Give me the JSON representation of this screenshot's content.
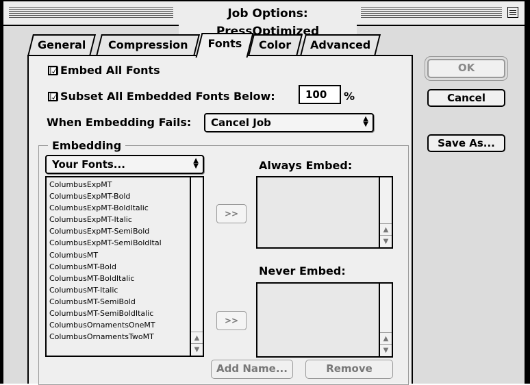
{
  "window": {
    "title": "Job Options: PressOptimized"
  },
  "tabs": [
    {
      "label": "General"
    },
    {
      "label": "Compression"
    },
    {
      "label": "Fonts"
    },
    {
      "label": "Color"
    },
    {
      "label": "Advanced"
    }
  ],
  "fonts": {
    "embed_all": {
      "label": "Embed All Fonts",
      "checked": true,
      "mark": "☑"
    },
    "subset": {
      "label": "Subset All Embedded Fonts Below:",
      "checked": true,
      "mark": "☑",
      "value": "100",
      "unit": "%"
    },
    "embedding_fails": {
      "label": "When Embedding Fails:",
      "value": "Cancel Job"
    }
  },
  "embedding": {
    "group_title": "Embedding",
    "source_popup": "Your Fonts...",
    "font_list": [
      "ColumbusExpMT",
      "ColumbusExpMT-Bold",
      "ColumbusExpMT-BoldItalic",
      "ColumbusExpMT-Italic",
      "ColumbusExpMT-SemiBold",
      "ColumbusExpMT-SemiBoldItal",
      "ColumbusMT",
      "ColumbusMT-Bold",
      "ColumbusMT-BoldItalic",
      "ColumbusMT-Italic",
      "ColumbusMT-SemiBold",
      "ColumbusMT-SemiBoldItalic",
      "ColumbusOrnamentsOneMT",
      "ColumbusOrnamentsTwoMT"
    ],
    "add_arrow_label": ">>",
    "always_embed_label": "Always Embed:",
    "never_embed_label": "Never Embed:",
    "add_name_label": "Add Name...",
    "remove_label": "Remove"
  },
  "buttons": {
    "ok": "OK",
    "cancel": "Cancel",
    "save_as": "Save As..."
  },
  "icons": {
    "popup_arrows": "▲▼",
    "scroll_up": "▲",
    "scroll_down": "▼"
  }
}
